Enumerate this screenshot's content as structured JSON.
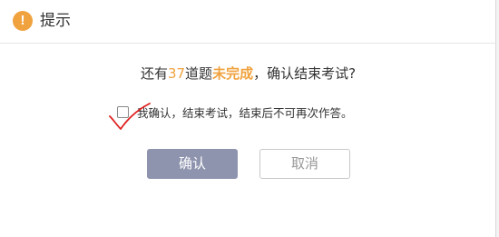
{
  "dialog": {
    "title": "提示",
    "icon": "warning-icon",
    "message": {
      "prefix": "还有",
      "count": "37",
      "middle": "道题",
      "highlight": "未完成",
      "suffix": "，确认结束考试?"
    },
    "confirm_checkbox": {
      "checked": false,
      "label": "我确认，结束考试，结束后不可再次作答。"
    },
    "buttons": {
      "ok_label": "确认",
      "cancel_label": "取消"
    }
  },
  "colors": {
    "accent": "#f0a23e",
    "ok_button": "#8e94ae",
    "annotation_mark": "#e02020"
  }
}
